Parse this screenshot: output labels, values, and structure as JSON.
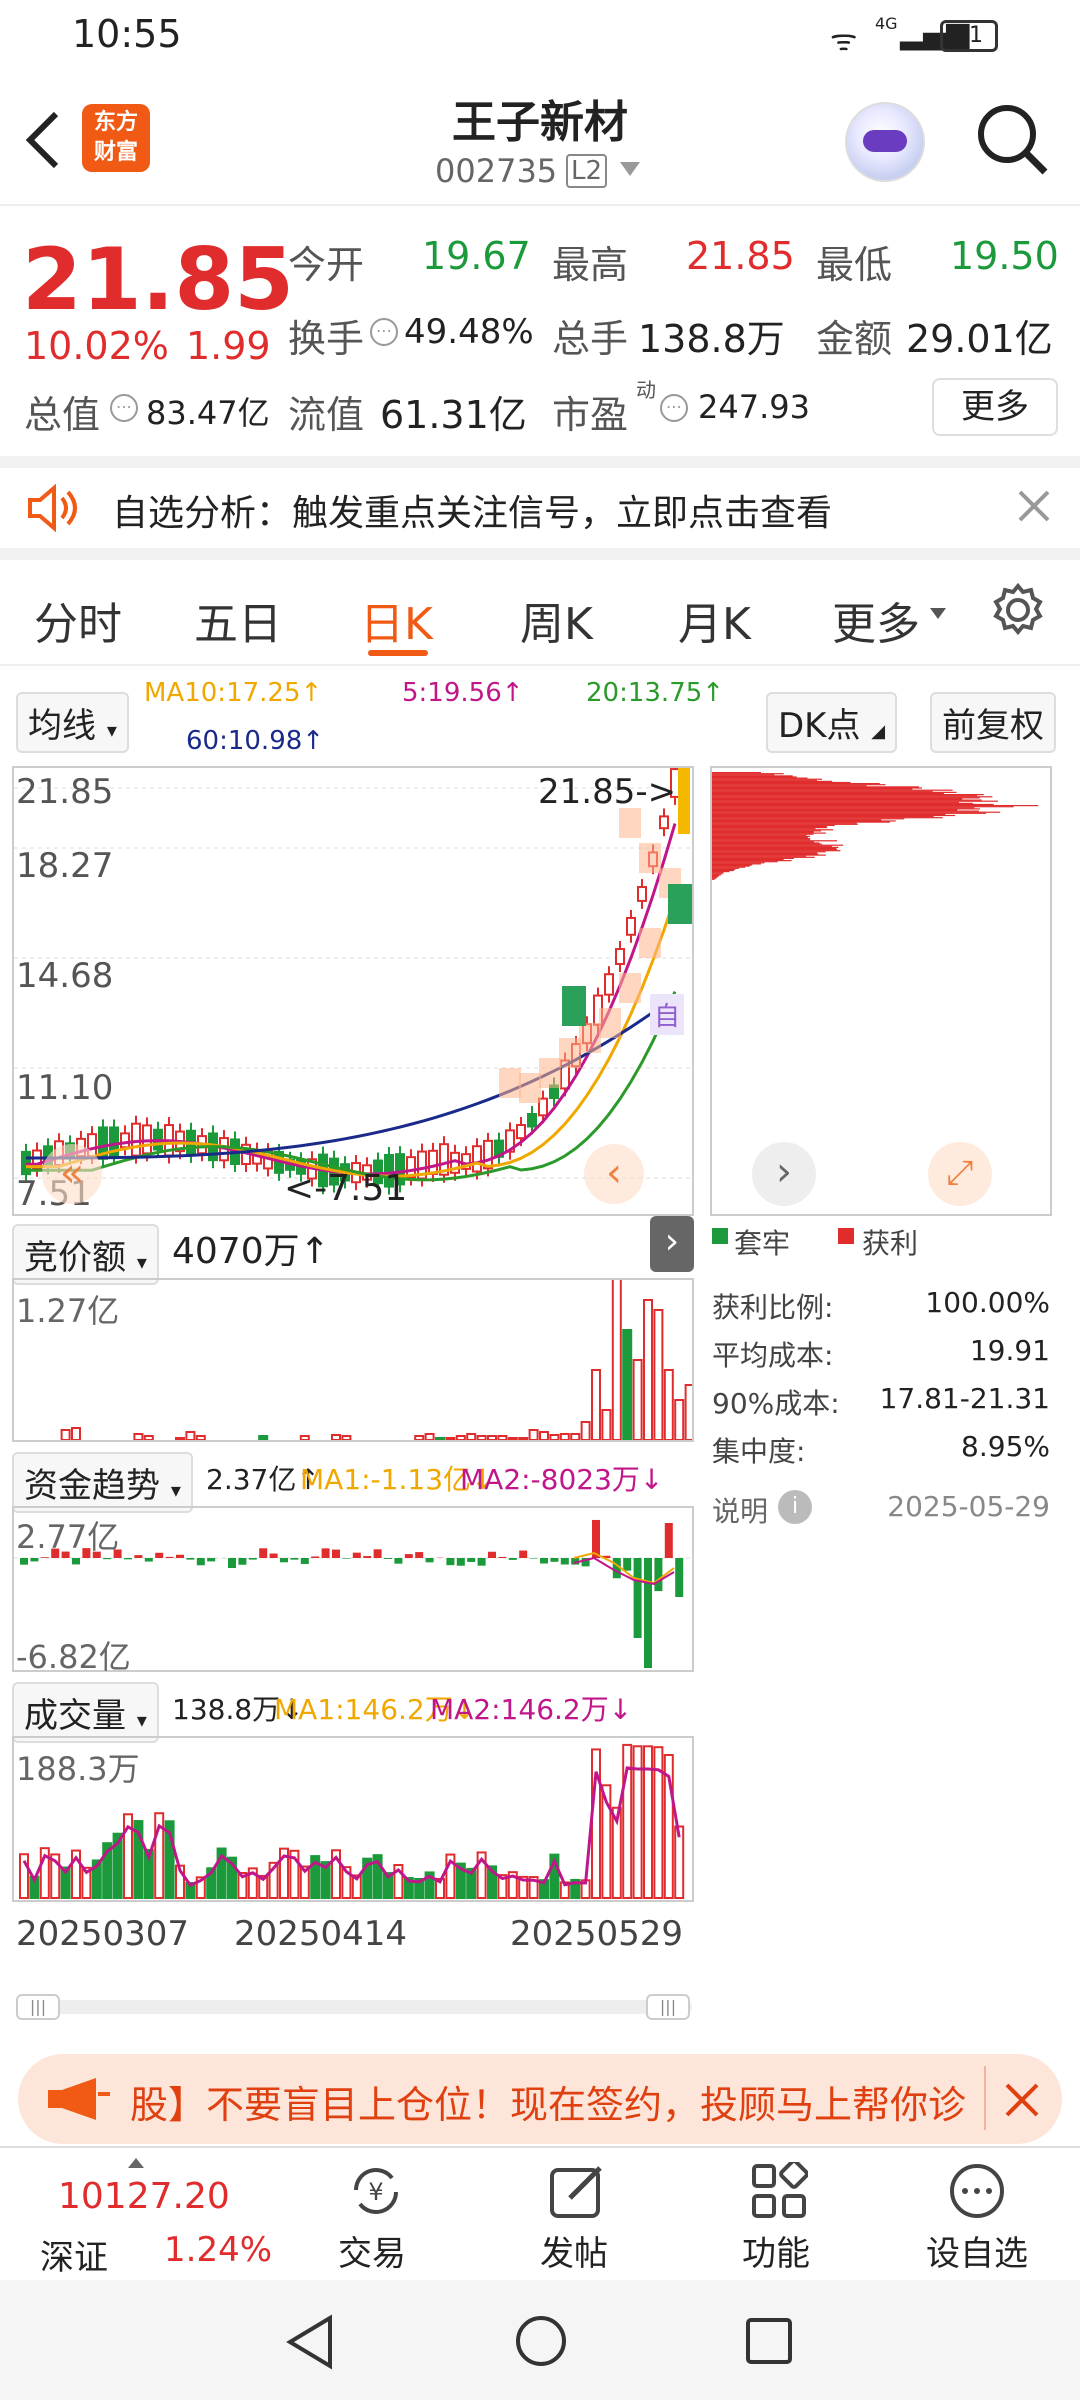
{
  "status": {
    "time": "10:55",
    "battery": "31",
    "net": "4G"
  },
  "header": {
    "title": "王子新材",
    "code": "002735",
    "badge": "L2",
    "logo_top": "东方",
    "logo_bottom": "财富"
  },
  "quote": {
    "price": "21.85",
    "pct": "10.02%",
    "chg": "1.99",
    "open_label": "今开",
    "open": "19.67",
    "high_label": "最高",
    "high": "21.85",
    "low_label": "最低",
    "low": "19.50",
    "turnover_label": "换手",
    "turnover": "49.48%",
    "volume_label": "总手",
    "volume": "138.8万",
    "amount_label": "金额",
    "amount": "29.01亿",
    "mktcap_label": "总值",
    "mktcap": "83.47亿",
    "float_label": "流值",
    "float": "61.31亿",
    "pe_label": "市盈",
    "pe_sup": "动",
    "pe": "247.93",
    "more": "更多"
  },
  "alert": {
    "text": "自选分析：触发重点关注信号，立即点击查看"
  },
  "tabs": {
    "items": [
      "分时",
      "五日",
      "日K",
      "周K",
      "月K"
    ],
    "more": "更多",
    "active": "日K"
  },
  "ma": {
    "selector": "均线",
    "ma10": "MA10:17.25↑",
    "ma5": "5:19.56↑",
    "ma20": "20:13.75↑",
    "ma60": "60:10.98↑",
    "dk": "DK点",
    "fq": "前复权"
  },
  "kchart": {
    "y_labels": [
      "21.85",
      "18.27",
      "14.68",
      "11.10",
      "7.51"
    ],
    "high_note": "21.85->",
    "low_note": "<-7.51",
    "marker": "自"
  },
  "chip": {
    "legend_a": "套牢",
    "legend_b": "获利",
    "rows": [
      {
        "k": "获利比例:",
        "v": "100.00%"
      },
      {
        "k": "平均成本:",
        "v": "19.91"
      },
      {
        "k": "90%成本:",
        "v": "17.81-21.31"
      },
      {
        "k": "集中度:",
        "v": "8.95%"
      }
    ],
    "note": "说明",
    "date": "2025-05-29"
  },
  "bid": {
    "selector": "竞价额",
    "value": "4070万↑",
    "ymax": "1.27亿"
  },
  "fund": {
    "selector": "资金趋势",
    "value": "2.37亿↑",
    "ma1": "MA1:-1.13亿↓",
    "ma2": "MA2:-8023万↓",
    "ymax": "2.77亿",
    "ymin": "-6.82亿"
  },
  "vol": {
    "selector": "成交量",
    "value": "138.8万↓",
    "ma1": "MA1:146.2万↓",
    "ma2": "MA2:146.2万↓",
    "ymax": "188.3万"
  },
  "dates": [
    "20250307",
    "20250414",
    "20250529"
  ],
  "ad": {
    "text": "股】不要盲目上仓位！现在签约，投顾马上帮你诊"
  },
  "index": {
    "value": "10127.20",
    "name": "深证",
    "pct": "1.24%"
  },
  "nav": [
    "交易",
    "发帖",
    "功能",
    "设自选"
  ],
  "colors": {
    "up": "#e02c2c",
    "down": "#1a9a3a",
    "accent": "#f05a14",
    "ma5": "#c0168a",
    "ma10": "#f0a800",
    "ma20": "#2a9a2a",
    "ma60": "#1a2a8a"
  }
}
